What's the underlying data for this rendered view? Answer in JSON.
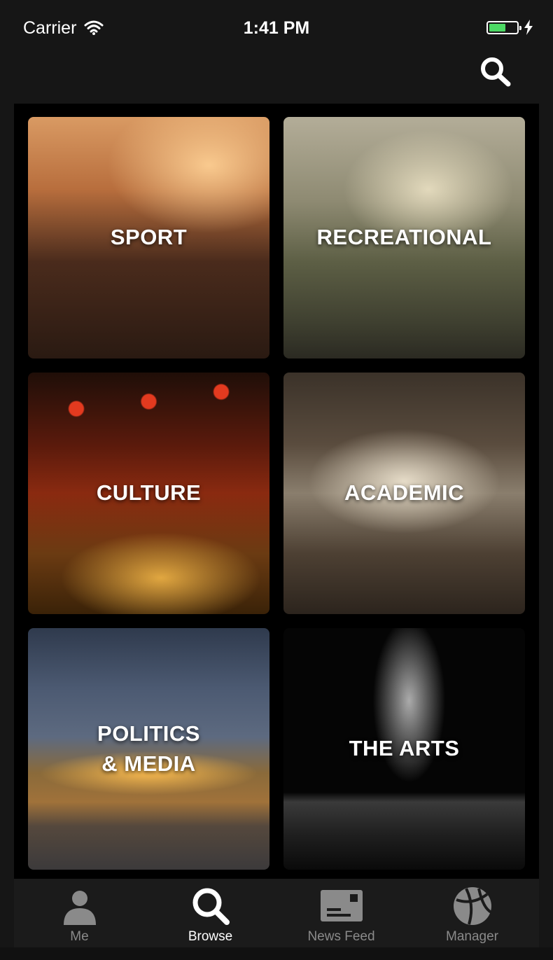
{
  "status_bar": {
    "carrier": "Carrier",
    "time": "1:41 PM",
    "battery_level": 0.6,
    "battery_color": "#4cd964"
  },
  "header": {
    "search_icon": "search-icon"
  },
  "categories": [
    {
      "label": "SPORT"
    },
    {
      "label": "RECREATIONAL"
    },
    {
      "label": "CULTURE"
    },
    {
      "label": "ACADEMIC"
    },
    {
      "label_line1": "POLITICS",
      "label_line2": "& MEDIA"
    },
    {
      "label": "THE ARTS"
    }
  ],
  "tab_bar": {
    "tabs": [
      {
        "label": "Me",
        "icon": "person-icon",
        "active": false
      },
      {
        "label": "Browse",
        "icon": "search-icon",
        "active": true
      },
      {
        "label": "News Feed",
        "icon": "news-card-icon",
        "active": false
      },
      {
        "label": "Manager",
        "icon": "ball-icon",
        "active": false
      }
    ],
    "active_color": "#ffffff",
    "inactive_color": "#8a8a8a"
  }
}
